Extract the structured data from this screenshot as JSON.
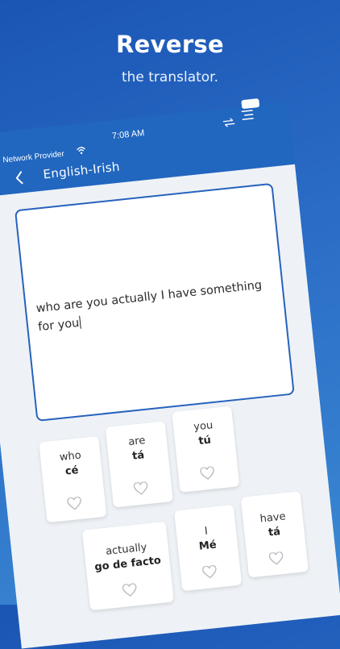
{
  "promo": {
    "title": "Reverse",
    "subtitle": "the translator."
  },
  "status_bar": {
    "carrier": "Network Provider",
    "time": "7:08 AM"
  },
  "nav": {
    "title": "English-Irish"
  },
  "input": {
    "value": "who are you actually I have something for you"
  },
  "word_cards": [
    {
      "source": "who",
      "target": "cé"
    },
    {
      "source": "are",
      "target": "tá"
    },
    {
      "source": "you",
      "target": "tú"
    },
    {
      "source": "actually",
      "target": "go de facto"
    },
    {
      "source": "I",
      "target": "Mé"
    },
    {
      "source": "have",
      "target": "tá"
    }
  ],
  "colors": {
    "accent": "#2166bf",
    "background_gradient_start": "#1b55b4",
    "background_gradient_end": "#3b89d3"
  }
}
